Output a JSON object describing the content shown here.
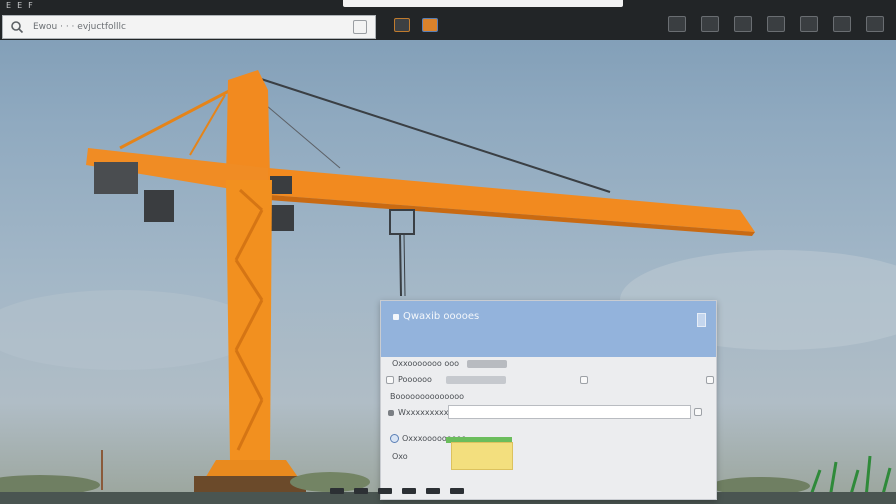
{
  "topbar": {
    "menu": [
      "E",
      "E",
      "F",
      "",
      "",
      "",
      "",
      ""
    ],
    "address_text": "Ewou · · · evjuctfolllc"
  },
  "toolbar": {
    "left_icons": [
      "media-icon",
      "image-icon"
    ],
    "right_icons": [
      "grid-icon",
      "user-icon",
      "flag-icon",
      "window-icon",
      "bars-icon",
      "panel-icon",
      "gear-icon"
    ]
  },
  "dialog": {
    "title": "Qwaxib ooooes",
    "section1_label": "Oxxooooooo ooo",
    "row2_label": "Poooooo",
    "row3_label": "Boooooooooooooo",
    "field_label": "Wxxxxxxxxxx",
    "field_value": "",
    "radio_label": "Oxxxooooooooo",
    "note_label": "Oxo",
    "progress_percent": 100
  },
  "colors": {
    "crane": "#f28a1f",
    "dialog_header": "#93b3dc",
    "highlight": "#f3df7e",
    "progress": "#6bbd5c"
  }
}
